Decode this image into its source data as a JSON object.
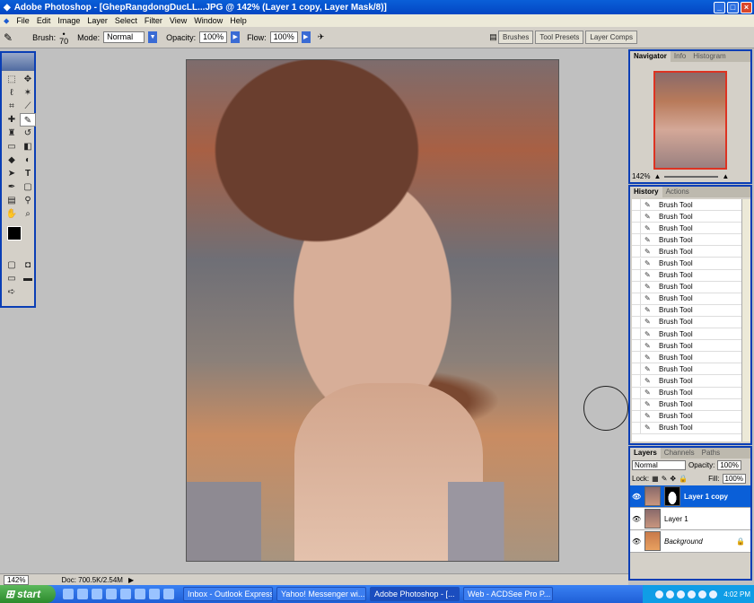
{
  "window": {
    "title": "Adobe Photoshop - [GhepRangdongDucLL...JPG @ 142% (Layer 1 copy, Layer Mask/8)]"
  },
  "menu": [
    "File",
    "Edit",
    "Image",
    "Layer",
    "Select",
    "Filter",
    "View",
    "Window",
    "Help"
  ],
  "options": {
    "brush_label": "Brush:",
    "brush_size": "70",
    "mode_label": "Mode:",
    "mode_value": "Normal",
    "opacity_label": "Opacity:",
    "opacity_value": "100%",
    "flow_label": "Flow:",
    "flow_value": "100%"
  },
  "wells": [
    "Brushes",
    "Tool Presets",
    "Layer Comps"
  ],
  "navigator": {
    "tabs": [
      "Navigator",
      "Info",
      "Histogram"
    ],
    "zoom": "142%"
  },
  "history": {
    "tabs": [
      "History",
      "Actions"
    ],
    "items": [
      "Brush Tool",
      "Brush Tool",
      "Brush Tool",
      "Brush Tool",
      "Brush Tool",
      "Brush Tool",
      "Brush Tool",
      "Brush Tool",
      "Brush Tool",
      "Brush Tool",
      "Brush Tool",
      "Brush Tool",
      "Brush Tool",
      "Brush Tool",
      "Brush Tool",
      "Brush Tool",
      "Brush Tool",
      "Brush Tool",
      "Brush Tool",
      "Brush Tool"
    ]
  },
  "layers": {
    "tabs": [
      "Layers",
      "Channels",
      "Paths"
    ],
    "blend": "Normal",
    "opacity_label": "Opacity:",
    "opacity": "100%",
    "lock_label": "Lock:",
    "fill_label": "Fill:",
    "fill": "100%",
    "items": [
      {
        "name": "Layer 1 copy",
        "selected": true
      },
      {
        "name": "Layer 1",
        "selected": false
      },
      {
        "name": "Background",
        "selected": false
      }
    ]
  },
  "status": {
    "zoom": "142%",
    "doc": "Doc: 700.5K/2.54M"
  },
  "taskbar": {
    "start": "start",
    "tasks": [
      "Inbox - Outlook Express",
      "Yahoo! Messenger wi...",
      "Adobe Photoshop - [...",
      "Web - ACDSee Pro P..."
    ],
    "time": "4:02 PM"
  }
}
